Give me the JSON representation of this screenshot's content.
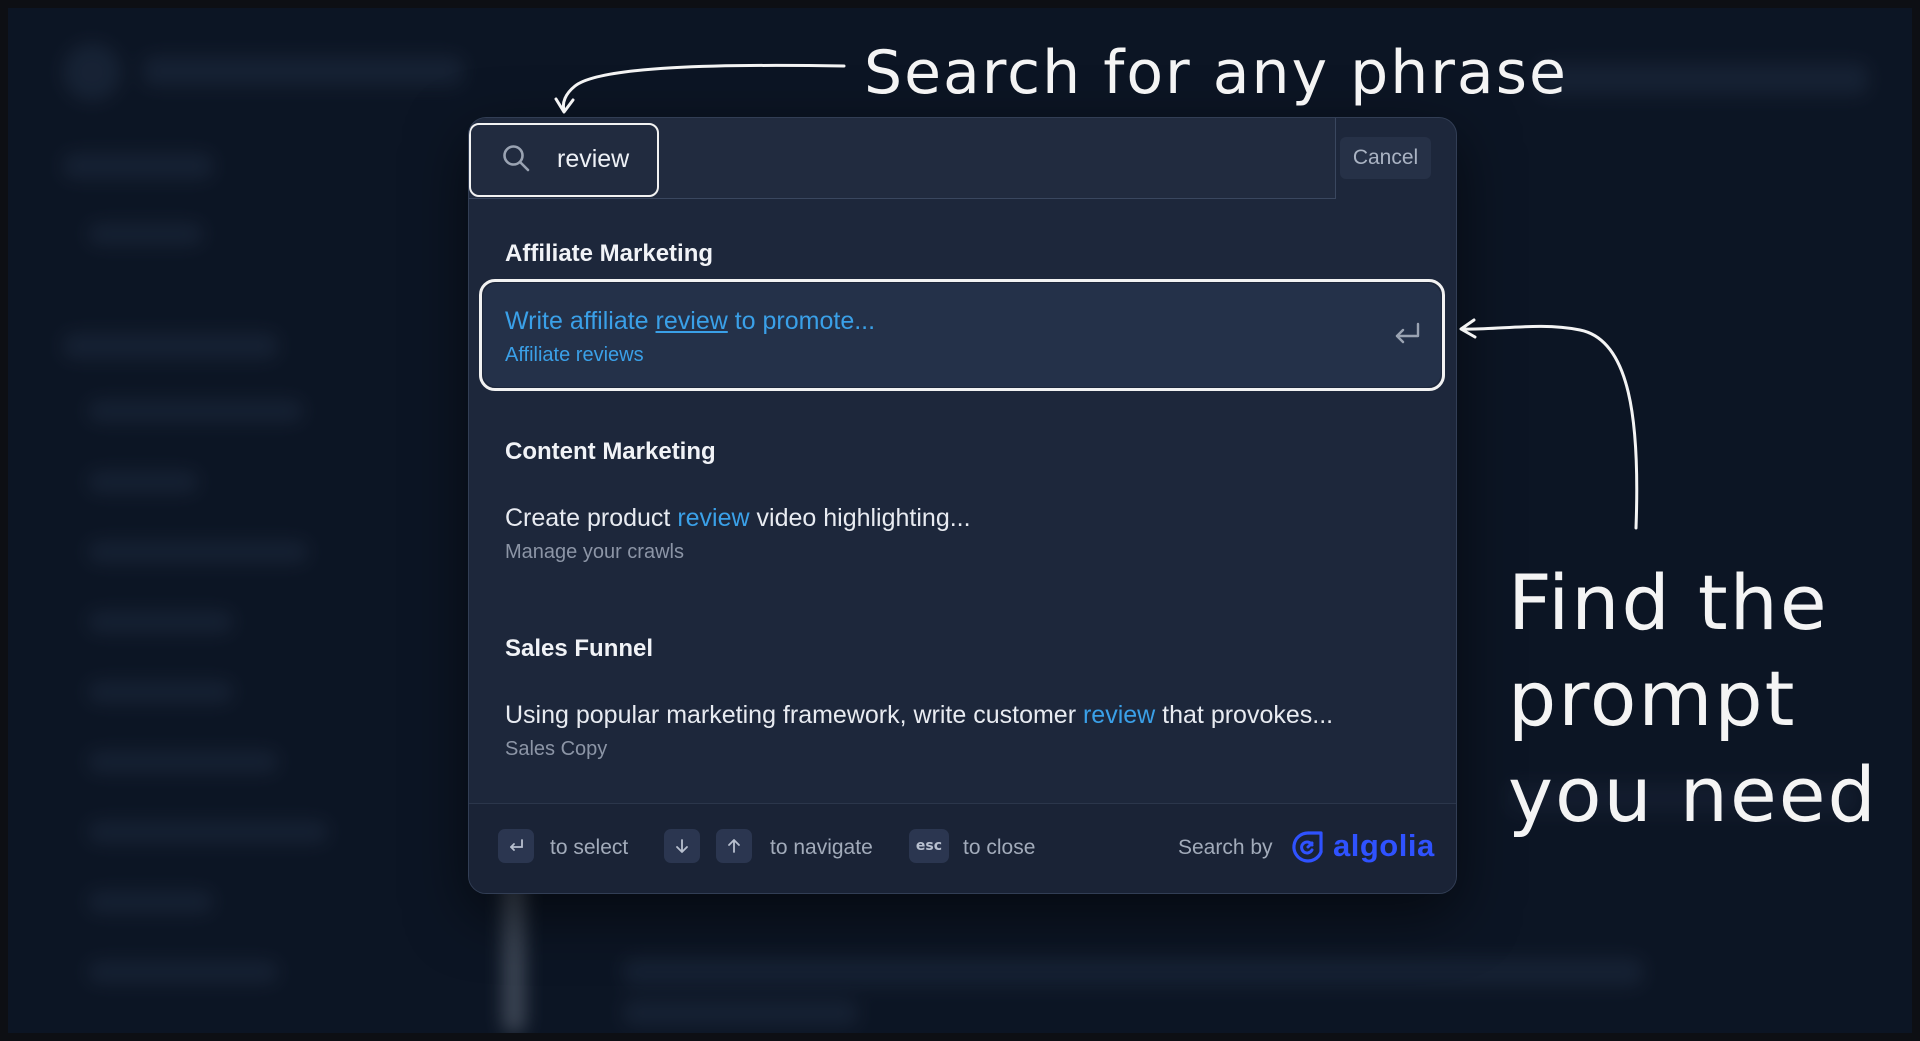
{
  "search": {
    "query": "review",
    "cancel_label": "Cancel"
  },
  "groups": [
    {
      "title": "Affiliate Marketing",
      "result": {
        "before": "Write affiliate ",
        "match": "review",
        "after": " to promote...",
        "subtitle": "Affiliate reviews",
        "selected": true
      }
    },
    {
      "title": "Content Marketing",
      "result": {
        "before": "Create product ",
        "match": "review",
        "after": " video highlighting...",
        "subtitle": "Manage your crawls",
        "selected": false
      }
    },
    {
      "title": "Sales Funnel",
      "result": {
        "before": "Using popular marketing framework, write customer ",
        "match": "review",
        "after": " that provokes...",
        "subtitle": "Sales Copy",
        "selected": false
      }
    }
  ],
  "footer": {
    "select_label": "to select",
    "navigate_label": "to navigate",
    "esc_key": "esc",
    "close_label": "to close",
    "search_by_label": "Search by",
    "brand": "algolia"
  },
  "annotations": {
    "top": "Search for any phrase",
    "side": [
      "Find the",
      "prompt",
      "you need"
    ]
  },
  "colors": {
    "accent": "#3aa0e8",
    "algolia": "#2f52ff",
    "modal_bg": "#1d273b"
  },
  "icons": [
    "search-icon",
    "enter-icon",
    "arrow-down-icon",
    "arrow-up-icon",
    "algolia-logo-icon"
  ]
}
